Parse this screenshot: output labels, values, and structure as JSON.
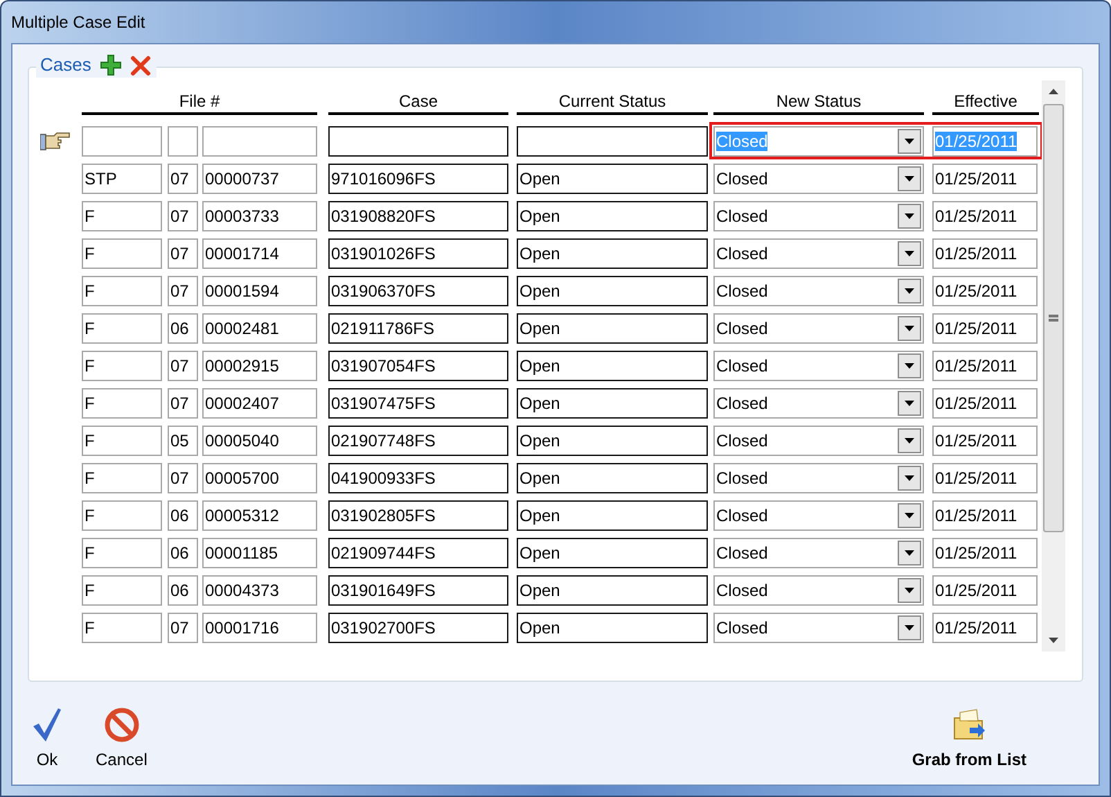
{
  "window": {
    "title": "Multiple Case Edit"
  },
  "group": {
    "title": "Cases"
  },
  "columns": [
    {
      "label": "File #"
    },
    {
      "label": "Case"
    },
    {
      "label": "Current Status"
    },
    {
      "label": "New Status"
    },
    {
      "label": "Effective"
    }
  ],
  "entry_row": {
    "selected": true,
    "new_status": "Closed",
    "effective": "01/25/2011"
  },
  "rows": [
    {
      "prefix": "STP",
      "year": "07",
      "number": "00000737",
      "case": "971016096FS",
      "current_status": "Open",
      "new_status": "Closed",
      "effective": "01/25/2011"
    },
    {
      "prefix": "F",
      "year": "07",
      "number": "00003733",
      "case": "031908820FS",
      "current_status": "Open",
      "new_status": "Closed",
      "effective": "01/25/2011"
    },
    {
      "prefix": "F",
      "year": "07",
      "number": "00001714",
      "case": "031901026FS",
      "current_status": "Open",
      "new_status": "Closed",
      "effective": "01/25/2011"
    },
    {
      "prefix": "F",
      "year": "07",
      "number": "00001594",
      "case": "031906370FS",
      "current_status": "Open",
      "new_status": "Closed",
      "effective": "01/25/2011"
    },
    {
      "prefix": "F",
      "year": "06",
      "number": "00002481",
      "case": "021911786FS",
      "current_status": "Open",
      "new_status": "Closed",
      "effective": "01/25/2011"
    },
    {
      "prefix": "F",
      "year": "07",
      "number": "00002915",
      "case": "031907054FS",
      "current_status": "Open",
      "new_status": "Closed",
      "effective": "01/25/2011"
    },
    {
      "prefix": "F",
      "year": "07",
      "number": "00002407",
      "case": "031907475FS",
      "current_status": "Open",
      "new_status": "Closed",
      "effective": "01/25/2011"
    },
    {
      "prefix": "F",
      "year": "05",
      "number": "00005040",
      "case": "021907748FS",
      "current_status": "Open",
      "new_status": "Closed",
      "effective": "01/25/2011"
    },
    {
      "prefix": "F",
      "year": "07",
      "number": "00005700",
      "case": "041900933FS",
      "current_status": "Open",
      "new_status": "Closed",
      "effective": "01/25/2011"
    },
    {
      "prefix": "F",
      "year": "06",
      "number": "00005312",
      "case": "031902805FS",
      "current_status": "Open",
      "new_status": "Closed",
      "effective": "01/25/2011"
    },
    {
      "prefix": "F",
      "year": "06",
      "number": "00001185",
      "case": "021909744FS",
      "current_status": "Open",
      "new_status": "Closed",
      "effective": "01/25/2011"
    },
    {
      "prefix": "F",
      "year": "06",
      "number": "00004373",
      "case": "031901649FS",
      "current_status": "Open",
      "new_status": "Closed",
      "effective": "01/25/2011"
    },
    {
      "prefix": "F",
      "year": "07",
      "number": "00001716",
      "case": "031902700FS",
      "current_status": "Open",
      "new_status": "Closed",
      "effective": "01/25/2011"
    }
  ],
  "buttons": [
    {
      "kind": "ok",
      "label": "Ok"
    },
    {
      "kind": "cancel",
      "label": "Cancel"
    },
    {
      "kind": "grab",
      "label": "Grab from List"
    }
  ]
}
